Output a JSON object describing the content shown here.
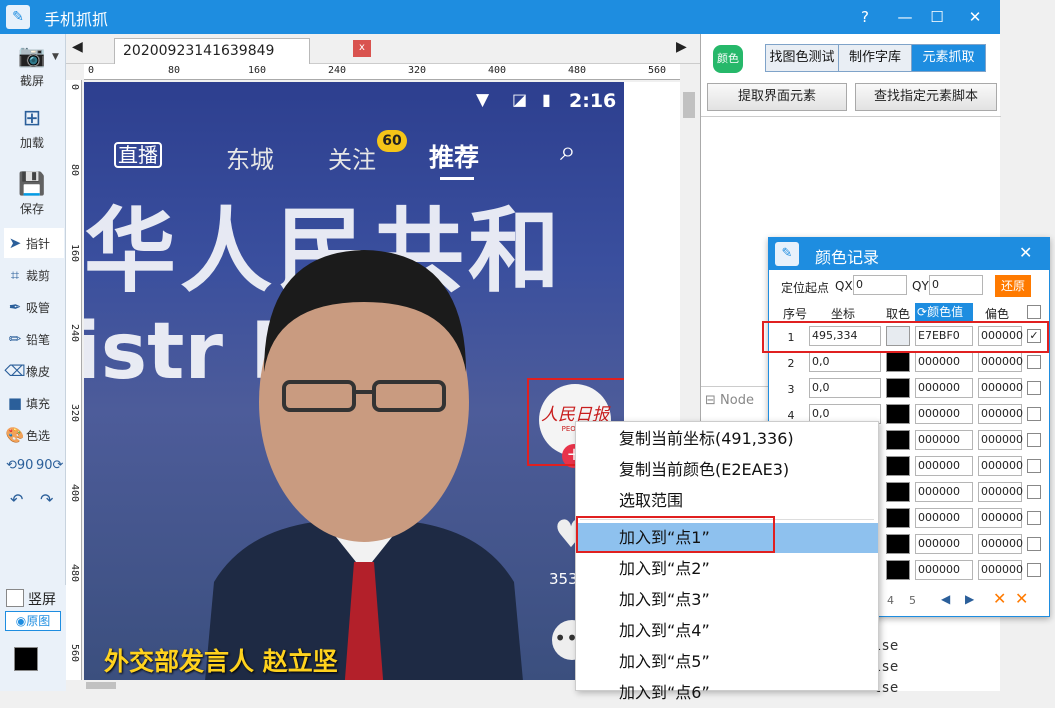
{
  "app": {
    "title": "手机抓抓"
  },
  "window_controls": {
    "help": "?",
    "minimize": "—",
    "maximize": "☐",
    "close": "✕"
  },
  "toolbar": {
    "screenshot": "截屏",
    "load": "加载",
    "save": "保存",
    "tools": [
      "指针",
      "裁剪",
      "吸管",
      "铅笔",
      "橡皮",
      "填充",
      "色选"
    ],
    "portrait_label": "竖屏",
    "original_label": "原图"
  },
  "tabs": {
    "file_tab": "20200923141639849",
    "close": "x"
  },
  "ruler": {
    "h_ticks": [
      "0",
      "80",
      "160",
      "240",
      "320",
      "400",
      "480",
      "560"
    ],
    "v_ticks": [
      "0",
      "80",
      "160",
      "240",
      "320",
      "400",
      "480",
      "560"
    ]
  },
  "phone": {
    "time": "2:16",
    "nav": [
      "直播",
      "东城",
      "关注",
      "推荐"
    ],
    "badge": "60",
    "caption": "外交部发言人 赵立坚",
    "bg_line1": "华人民共和",
    "bg_line2": "istr   For",
    "like_count": "353",
    "logo_text": "人民日报",
    "logo_sub": "PEOPLE"
  },
  "right_panel": {
    "color_btn": "颜色",
    "seg_tabs": [
      "找图色测试",
      "制作字库",
      "元素抓取"
    ],
    "actions": [
      "提取界面元素",
      "查找指定元素脚本"
    ],
    "node_label": "Node",
    "node_values": [
      "lse",
      "lse",
      "lse"
    ]
  },
  "color_window": {
    "title": "颜色记录",
    "origin_label": "定位起点",
    "qx_label": "QX",
    "qx_value": "0",
    "qy_label": "QY",
    "qy_value": "0",
    "restore_btn": "还原",
    "headers": {
      "no": "序号",
      "coord": "坐标",
      "pick": "取色",
      "value": "颜色值",
      "offset": "偏色"
    },
    "rows": [
      {
        "no": "1",
        "coord": "495,334",
        "value": "E7EBF0",
        "offset": "000000"
      },
      {
        "no": "2",
        "coord": "0,0",
        "value": "000000",
        "offset": "000000"
      },
      {
        "no": "3",
        "coord": "0,0",
        "value": "000000",
        "offset": "000000"
      },
      {
        "no": "4",
        "coord": "0,0",
        "value": "000000",
        "offset": "000000"
      },
      {
        "no": "",
        "coord": "",
        "value": "000000",
        "offset": "000000"
      },
      {
        "no": "",
        "coord": "",
        "value": "000000",
        "offset": "000000"
      },
      {
        "no": "",
        "coord": "",
        "value": "000000",
        "offset": "000000"
      },
      {
        "no": "",
        "coord": "",
        "value": "000000",
        "offset": "000000"
      },
      {
        "no": "",
        "coord": "",
        "value": "000000",
        "offset": "000000"
      },
      {
        "no": "",
        "coord": "",
        "value": "000000",
        "offset": "000000"
      }
    ],
    "pages": [
      "4",
      "5"
    ]
  },
  "context_menu": {
    "items": [
      "复制当前坐标(491,336)",
      "复制当前颜色(E2EAE3)",
      "选取范围",
      "加入到“点1”",
      "加入到“点2”",
      "加入到“点3”",
      "加入到“点4”",
      "加入到“点5”",
      "加入到“点6”"
    ]
  },
  "colors": {
    "accent": "#1e8de0",
    "highlight": "#8ec1ee",
    "red_box": "#e02020",
    "badge": "#f5c518",
    "restore": "#ff7a00"
  }
}
